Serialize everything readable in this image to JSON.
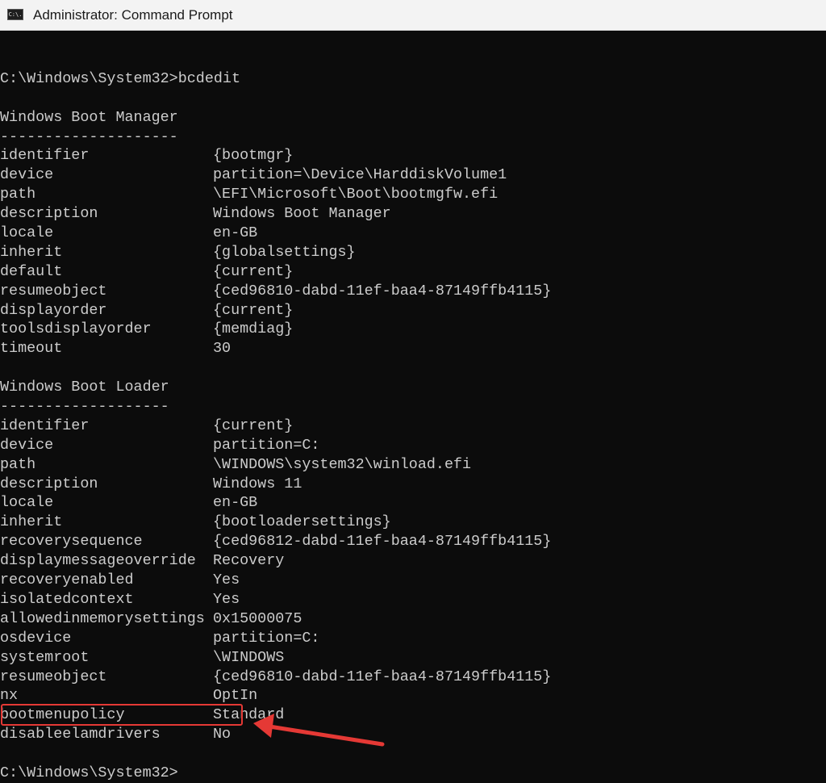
{
  "window": {
    "title": "Administrator: Command Prompt",
    "icon": "cmd-icon",
    "icon_text": "C:\\."
  },
  "console": {
    "prompt1": "C:\\Windows\\System32>bcdedit",
    "boot_manager": {
      "heading": "Windows Boot Manager",
      "underline": "--------------------",
      "entries": [
        {
          "key": "identifier",
          "value": "{bootmgr}"
        },
        {
          "key": "device",
          "value": "partition=\\Device\\HarddiskVolume1"
        },
        {
          "key": "path",
          "value": "\\EFI\\Microsoft\\Boot\\bootmgfw.efi"
        },
        {
          "key": "description",
          "value": "Windows Boot Manager"
        },
        {
          "key": "locale",
          "value": "en-GB"
        },
        {
          "key": "inherit",
          "value": "{globalsettings}"
        },
        {
          "key": "default",
          "value": "{current}"
        },
        {
          "key": "resumeobject",
          "value": "{ced96810-dabd-11ef-baa4-87149ffb4115}"
        },
        {
          "key": "displayorder",
          "value": "{current}"
        },
        {
          "key": "toolsdisplayorder",
          "value": "{memdiag}"
        },
        {
          "key": "timeout",
          "value": "30"
        }
      ]
    },
    "boot_loader": {
      "heading": "Windows Boot Loader",
      "underline": "-------------------",
      "entries": [
        {
          "key": "identifier",
          "value": "{current}"
        },
        {
          "key": "device",
          "value": "partition=C:"
        },
        {
          "key": "path",
          "value": "\\WINDOWS\\system32\\winload.efi"
        },
        {
          "key": "description",
          "value": "Windows 11"
        },
        {
          "key": "locale",
          "value": "en-GB"
        },
        {
          "key": "inherit",
          "value": "{bootloadersettings}"
        },
        {
          "key": "recoverysequence",
          "value": "{ced96812-dabd-11ef-baa4-87149ffb4115}"
        },
        {
          "key": "displaymessageoverride",
          "value": "Recovery"
        },
        {
          "key": "recoveryenabled",
          "value": "Yes"
        },
        {
          "key": "isolatedcontext",
          "value": "Yes"
        },
        {
          "key": "allowedinmemorysettings",
          "value": "0x15000075"
        },
        {
          "key": "osdevice",
          "value": "partition=C:"
        },
        {
          "key": "systemroot",
          "value": "\\WINDOWS"
        },
        {
          "key": "resumeobject",
          "value": "{ced96810-dabd-11ef-baa4-87149ffb4115}"
        },
        {
          "key": "nx",
          "value": "OptIn"
        },
        {
          "key": "bootmenupolicy",
          "value": "Standard"
        },
        {
          "key": "disableelamdrivers",
          "value": "No"
        }
      ]
    },
    "prompt2": "C:\\Windows\\System32>"
  },
  "annotation": {
    "color": "#e53935",
    "icon": "arrow-icon"
  }
}
